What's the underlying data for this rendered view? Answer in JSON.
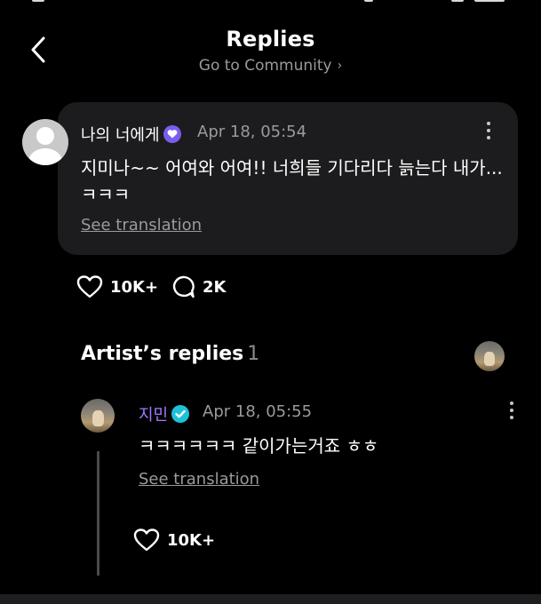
{
  "header": {
    "title": "Replies",
    "subtitle": "Go to Community",
    "subtitle_chevron": "›"
  },
  "post": {
    "username": "나의 너에게",
    "timestamp": "Apr 18, 05:54",
    "text": "지미나~~ 어여와 어여!!  너희들 기다리다 늙는다 내가...ㅋㅋㅋ",
    "see_translation": "See translation",
    "likes": "10K+",
    "comments": "2K"
  },
  "artist_replies": {
    "label": "Artist’s replies",
    "count": "1"
  },
  "reply": {
    "username": "지민",
    "timestamp": "Apr 18, 05:55",
    "text": "ㅋㅋㅋㅋㅋㅋ 같이가는거죠 ㅎㅎ",
    "see_translation": "See translation",
    "likes": "10K+"
  },
  "colors": {
    "background": "#000000",
    "card": "#1c1c1e",
    "artist_name": "#9f7bff",
    "fan_badge": "#7b5cf0",
    "artist_badge": "#1ec2d8",
    "muted_text": "#9a9a9a"
  },
  "icons": [
    "back-arrow-icon",
    "chevron-right-icon",
    "verified-badge-icon",
    "more-vertical-icon",
    "heart-icon",
    "comment-icon"
  ]
}
